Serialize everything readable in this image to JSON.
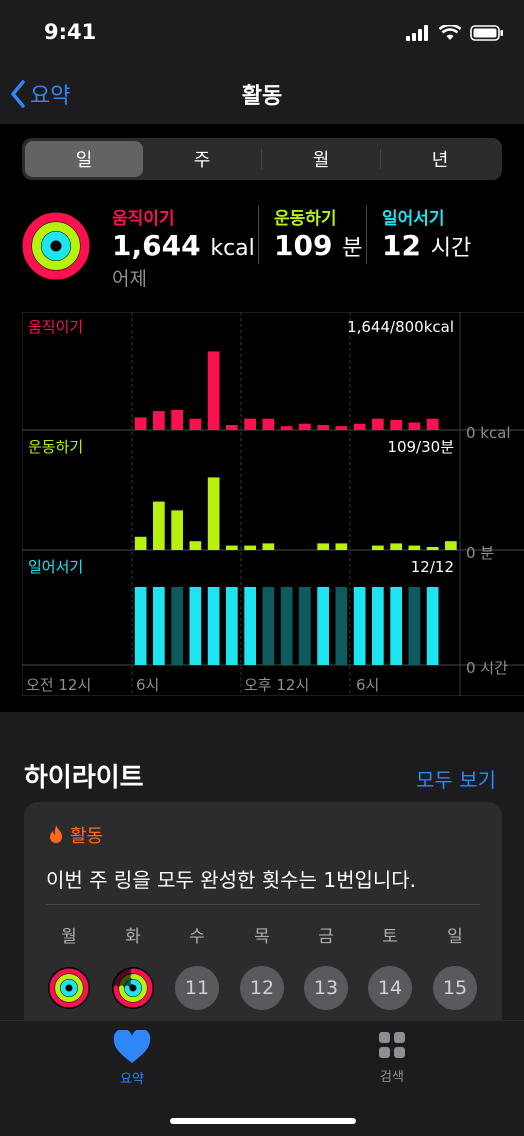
{
  "status": {
    "time": "9:41"
  },
  "nav": {
    "back_label": "요약",
    "title": "활동"
  },
  "segments": [
    "일",
    "주",
    "월",
    "년"
  ],
  "summary": {
    "move": {
      "label": "움직이기",
      "value": "1,644",
      "unit": "kcal",
      "color": "#fa114f"
    },
    "exercise": {
      "label": "운동하기",
      "value": "109",
      "unit": "분",
      "color": "#b7f20f"
    },
    "stand": {
      "label": "일어서기",
      "value": "12",
      "unit": "시간",
      "color": "#1de4f0"
    },
    "day": "어제"
  },
  "chart_data": [
    {
      "type": "bar",
      "title": "움직이기",
      "total_label": "1,644/800kcal",
      "axis_min_label": "0 kcal",
      "color": "#fa114f",
      "values": [
        0,
        0,
        0,
        0,
        0,
        0,
        20,
        30,
        32,
        18,
        125,
        8,
        18,
        18,
        6,
        10,
        8,
        6,
        10,
        18,
        16,
        12,
        18,
        0
      ]
    },
    {
      "type": "bar",
      "title": "운동하기",
      "total_label": "109/30분",
      "axis_min_label": "0 분",
      "color": "#b7f20f",
      "values": [
        0,
        0,
        0,
        0,
        0,
        0,
        6,
        22,
        18,
        4,
        33,
        2,
        2,
        3,
        0,
        0,
        3,
        3,
        0,
        2,
        3,
        2,
        1,
        4
      ]
    },
    {
      "type": "bar",
      "title": "일어서기",
      "total_label": "12/12",
      "axis_min_label": "0 시간",
      "color": "#1de4f0",
      "dim_color": "#0d5a5f",
      "values": [
        0,
        0,
        0,
        0,
        0,
        0,
        1,
        1,
        0.5,
        1,
        1,
        1,
        1,
        0.5,
        0.5,
        0.5,
        1,
        0.5,
        1,
        1,
        1,
        0.5,
        1,
        0
      ]
    }
  ],
  "x_labels": [
    "오전 12시",
    "6시",
    "오후 12시",
    "6시"
  ],
  "highlights": {
    "title": "하이라이트",
    "see_all": "모두 보기",
    "card_category": "활동",
    "card_text": "이번 주 링을 모두 완성한 횟수는 1번입니다.",
    "days": [
      "월",
      "화",
      "수",
      "목",
      "금",
      "토",
      "일"
    ],
    "dates": [
      "11",
      "12",
      "13",
      "14",
      "15"
    ]
  },
  "tabs": {
    "summary": "요약",
    "browse": "검색"
  }
}
